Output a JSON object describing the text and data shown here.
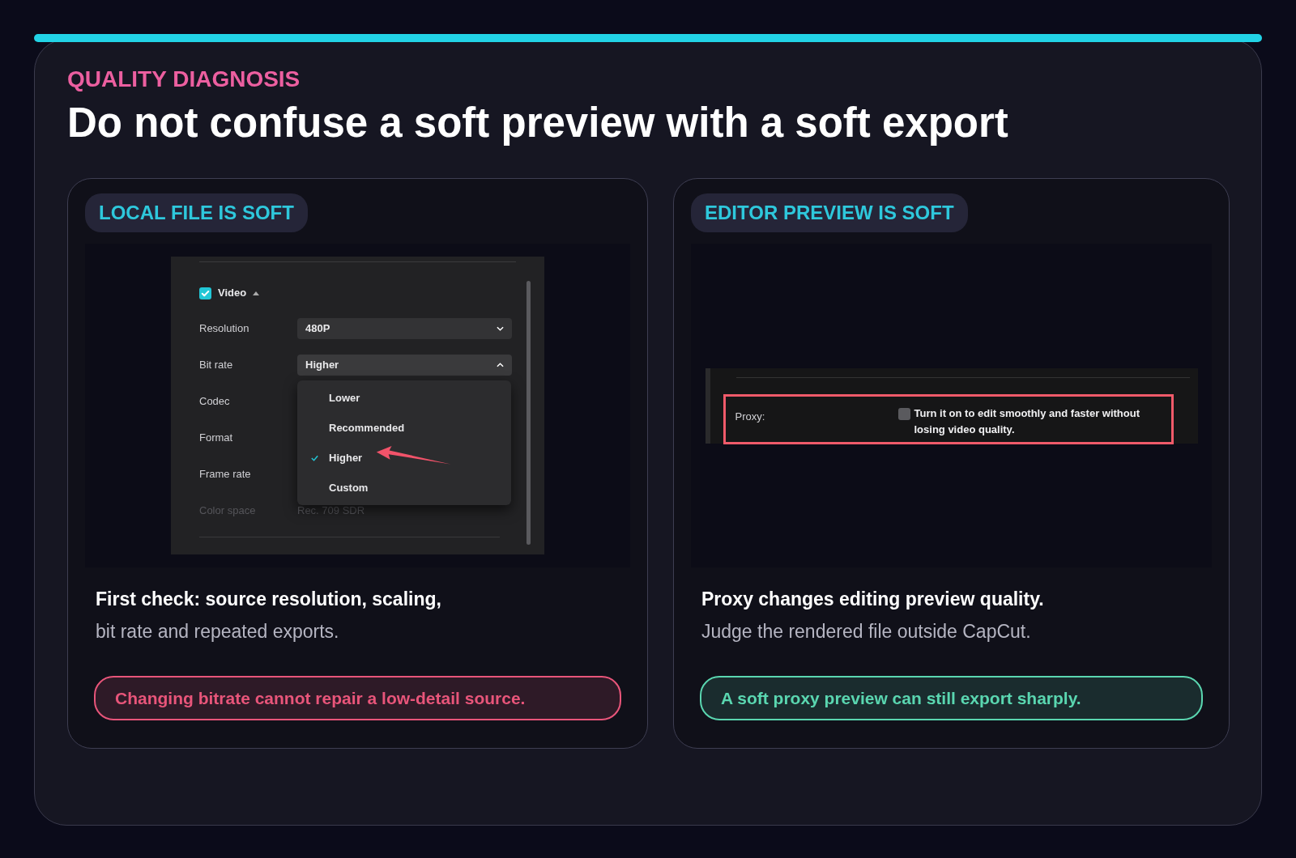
{
  "eyebrow": "QUALITY DIAGNOSIS",
  "title": "Do not confuse a soft preview with a soft export",
  "panels": [
    {
      "tag": "LOCAL FILE IS SOFT",
      "screenshot": {
        "kind": "export_settings",
        "section": {
          "label": "Video",
          "checked": true
        },
        "rows": [
          {
            "label": "Resolution",
            "value": "480P",
            "expanded": false,
            "disabled": false
          },
          {
            "label": "Bit rate",
            "value": "Higher",
            "expanded": true,
            "disabled": false,
            "options": [
              {
                "label": "Lower",
                "selected": false
              },
              {
                "label": "Recommended",
                "selected": false
              },
              {
                "label": "Higher",
                "selected": true
              },
              {
                "label": "Custom",
                "selected": false
              }
            ]
          },
          {
            "label": "Codec",
            "disabled": false
          },
          {
            "label": "Format",
            "disabled": false
          },
          {
            "label": "Frame rate",
            "disabled": false
          },
          {
            "label": "Color space",
            "value": "Rec. 709 SDR",
            "disabled": true
          }
        ]
      },
      "lead": "First check: source resolution, scaling,",
      "body": "bit rate and repeated exports.",
      "callout": {
        "text": "Changing bitrate cannot repair a low-detail source.",
        "color": "#e8557a"
      }
    },
    {
      "tag": "EDITOR PREVIEW IS SOFT",
      "screenshot": {
        "kind": "proxy_setting",
        "label": "Proxy:",
        "checked": false,
        "description": "Turn it on to edit smoothly and faster without losing video quality."
      },
      "lead": "Proxy changes editing preview quality.",
      "body": "Judge the rendered file outside CapCut.",
      "callout": {
        "text": "A soft proxy preview can still export sharply.",
        "color": "#5ad6b0"
      }
    }
  ]
}
